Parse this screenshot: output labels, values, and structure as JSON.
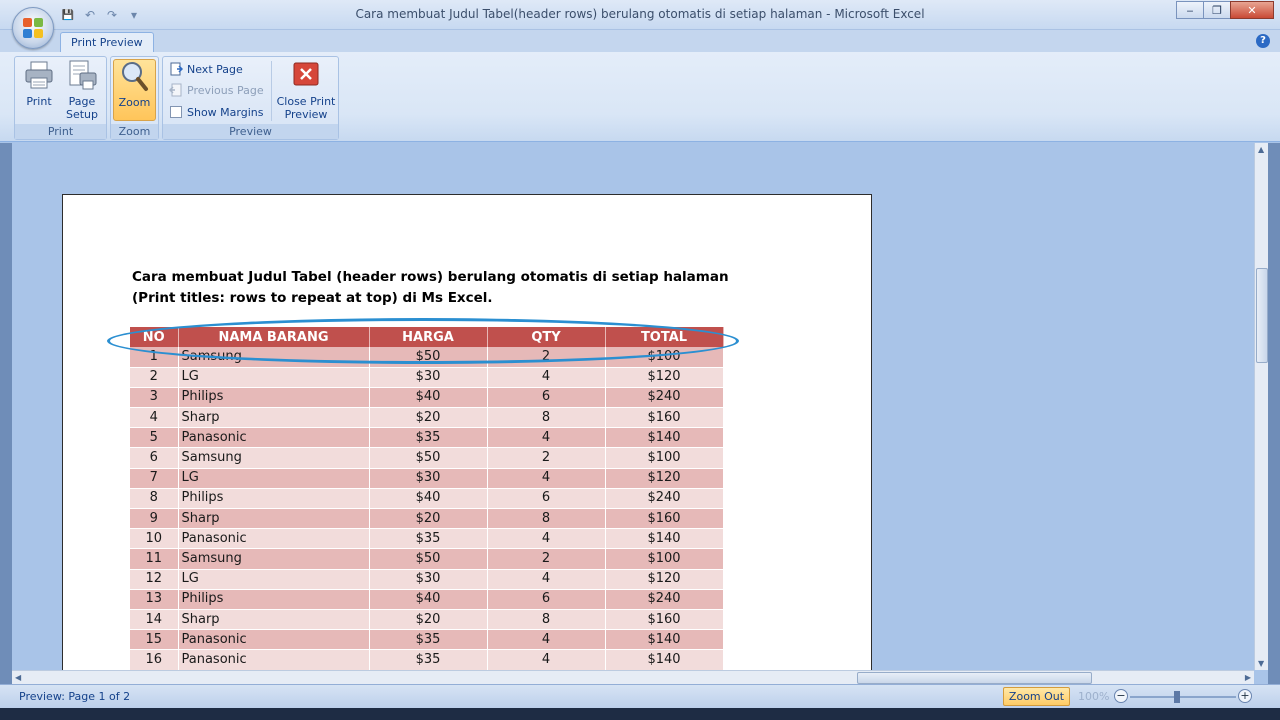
{
  "window": {
    "title": "Cara membuat Judul Tabel(header rows) berulang otomatis di setiap halaman - Microsoft Excel",
    "minimize": "‒",
    "maximize": "❐",
    "close": "✕"
  },
  "quick_access": {
    "save": "💾",
    "undo": "↶",
    "redo": "↷",
    "customize": "▾"
  },
  "ribbon": {
    "tab": "Print Preview",
    "help": "?",
    "groups": {
      "print": {
        "label": "Print",
        "print_btn": "Print",
        "page_setup_line1": "Page",
        "page_setup_line2": "Setup"
      },
      "zoom": {
        "label": "Zoom",
        "zoom_btn": "Zoom"
      },
      "preview": {
        "label": "Preview",
        "next_page": "Next Page",
        "previous_page": "Previous Page",
        "show_margins": "Show Margins",
        "close_line1": "Close Print",
        "close_line2": "Preview"
      }
    }
  },
  "document": {
    "title_line1": "Cara membuat Judul Tabel (header rows) berulang otomatis di setiap halaman",
    "title_line2": "(Print titles: rows to repeat at top) di Ms Excel.",
    "headers": [
      "NO",
      "NAMA BARANG",
      "HARGA",
      "QTY",
      "TOTAL"
    ],
    "rows": [
      [
        "1",
        "Samsung",
        "$50",
        "2",
        "$100"
      ],
      [
        "2",
        "LG",
        "$30",
        "4",
        "$120"
      ],
      [
        "3",
        "Philips",
        "$40",
        "6",
        "$240"
      ],
      [
        "4",
        "Sharp",
        "$20",
        "8",
        "$160"
      ],
      [
        "5",
        "Panasonic",
        "$35",
        "4",
        "$140"
      ],
      [
        "6",
        "Samsung",
        "$50",
        "2",
        "$100"
      ],
      [
        "7",
        "LG",
        "$30",
        "4",
        "$120"
      ],
      [
        "8",
        "Philips",
        "$40",
        "6",
        "$240"
      ],
      [
        "9",
        "Sharp",
        "$20",
        "8",
        "$160"
      ],
      [
        "10",
        "Panasonic",
        "$35",
        "4",
        "$140"
      ],
      [
        "11",
        "Samsung",
        "$50",
        "2",
        "$100"
      ],
      [
        "12",
        "LG",
        "$30",
        "4",
        "$120"
      ],
      [
        "13",
        "Philips",
        "$40",
        "6",
        "$240"
      ],
      [
        "14",
        "Sharp",
        "$20",
        "8",
        "$160"
      ],
      [
        "15",
        "Panasonic",
        "$35",
        "4",
        "$140"
      ],
      [
        "16",
        "Panasonic",
        "$35",
        "4",
        "$140"
      ]
    ]
  },
  "statusbar": {
    "preview_text": "Preview: Page 1 of 2",
    "zoom_out": "Zoom Out",
    "zoom_level": "100%",
    "minus": "−",
    "plus": "+"
  },
  "colors": {
    "header_red": "#c0504d",
    "row_dark": "#e6b9b8",
    "row_light": "#f2dcdb",
    "highlight_ellipse": "#2b8fd1"
  }
}
